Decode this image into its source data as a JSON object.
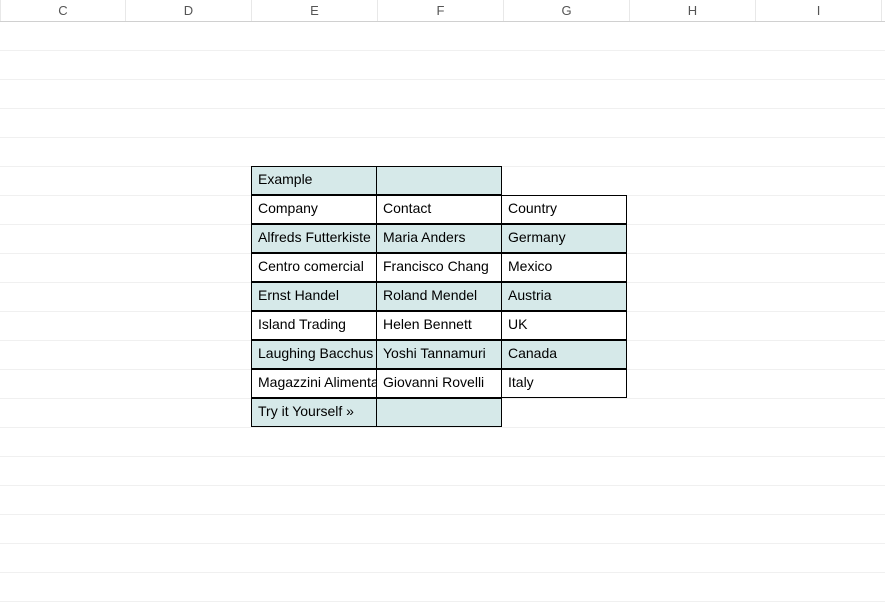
{
  "columns": [
    "C",
    "D",
    "E",
    "F",
    "G",
    "H",
    "I"
  ],
  "cells": {
    "r6": {
      "E": "Example"
    },
    "r7": {
      "E": "Company",
      "F": "Contact",
      "G": "Country"
    },
    "r8": {
      "E": "Alfreds Futterkiste",
      "F": "Maria Anders",
      "G": "Germany"
    },
    "r9": {
      "E": "Centro comercial",
      "F": "Francisco Chang",
      "G": "Mexico"
    },
    "r10": {
      "E": "Ernst Handel",
      "F": "Roland Mendel",
      "G": "Austria"
    },
    "r11": {
      "E": "Island Trading",
      "F": "Helen Bennett",
      "G": "UK"
    },
    "r12": {
      "E": "Laughing Bacchus",
      "F": "Yoshi Tannamuri",
      "G": "Canada"
    },
    "r13": {
      "E": "Magazzini Alimentari",
      "F": "Giovanni Rovelli",
      "G": "Italy"
    },
    "r14": {
      "E": "Try it Yourself »"
    }
  },
  "shaded_rows": [
    6,
    8,
    10,
    12,
    14
  ],
  "bordered": {
    "6": [
      "E",
      "F"
    ],
    "7": [
      "E",
      "F",
      "G"
    ],
    "8": [
      "E",
      "F",
      "G"
    ],
    "9": [
      "E",
      "F",
      "G"
    ],
    "10": [
      "E",
      "F",
      "G"
    ],
    "11": [
      "E",
      "F",
      "G"
    ],
    "12": [
      "E",
      "F",
      "G"
    ],
    "13": [
      "E",
      "F",
      "G"
    ],
    "14": [
      "E",
      "F"
    ]
  },
  "chart_data": {
    "type": "table",
    "title": "Example",
    "columns": [
      "Company",
      "Contact",
      "Country"
    ],
    "rows": [
      [
        "Alfreds Futterkiste",
        "Maria Anders",
        "Germany"
      ],
      [
        "Centro comercial",
        "Francisco Chang",
        "Mexico"
      ],
      [
        "Ernst Handel",
        "Roland Mendel",
        "Austria"
      ],
      [
        "Island Trading",
        "Helen Bennett",
        "UK"
      ],
      [
        "Laughing Bacchus",
        "Yoshi Tannamuri",
        "Canada"
      ],
      [
        "Magazzini Alimentari",
        "Giovanni Rovelli",
        "Italy"
      ]
    ],
    "footer": "Try it Yourself »"
  }
}
